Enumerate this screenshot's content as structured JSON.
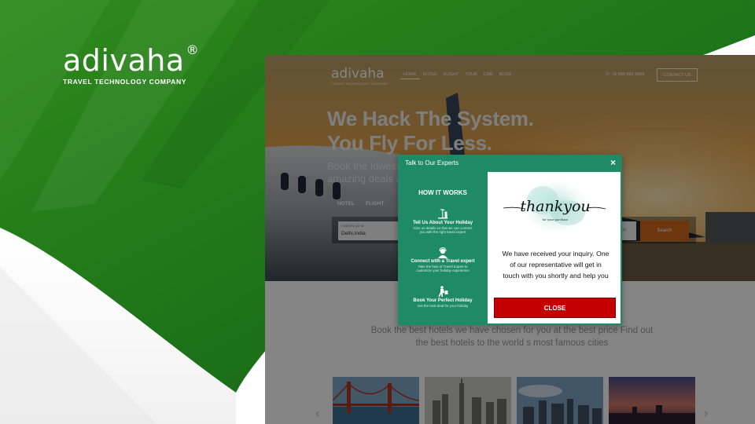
{
  "brand": {
    "name": "adivaha",
    "registered": "®",
    "tagline": "TRAVEL TECHNOLOGY COMPANY"
  },
  "site": {
    "logo_name": "adivaha",
    "logo_tagline": "TRAVEL TECHNOLOGY COMPANY",
    "nav": [
      "HOME",
      "HOTEL",
      "FLIGHT",
      "TOUR",
      "CAR",
      "BLOG"
    ],
    "phone": "P: +9 999 999 9999",
    "contact_label": "CONTACT US",
    "hero_line1": "We Hack The System.",
    "hero_line2": "You Fly For Less.",
    "hero_sub_line1": "Book the lowest a",
    "hero_sub_line2": "amazing deals and",
    "tabs": [
      "HOTEL",
      "FLIGHT"
    ],
    "search": {
      "label": "I want to go to",
      "value": "Delhi,India",
      "right_field": "(s)",
      "button": "Search"
    },
    "section_text_line1": "Book the best hotels we have chosen for you at the best price Find out",
    "section_text_line2": "the best hotels to the world s most famous cities",
    "arrows": {
      "prev": "‹",
      "next": "›"
    }
  },
  "modal": {
    "title": "Talk to Our Experts",
    "close_icon": "×",
    "how_title": "HOW IT WORKS",
    "steps": [
      {
        "icon": "holiday-icon",
        "title": "Tell Us About Your Holiday",
        "desc_line1": "Give us details so that we can connect",
        "desc_line2": "you with the right travel expert"
      },
      {
        "icon": "expert-icon",
        "title": "Connect with a Travel expert",
        "desc_line1": "Take the help of Travel Expert to",
        "desc_line2": "customize your holiday experience"
      },
      {
        "icon": "traveler-icon",
        "title": "Book Your Perfect Holiday",
        "desc_line1": "Get the best deal for your holiday",
        "desc_line2": ""
      }
    ],
    "thankyou_script": "thankyou",
    "thankyou_small": "for your purchase",
    "message_line1": "We have received your inquiry. One",
    "message_line2": "of our representative will get in",
    "message_line3": "touch with you shortly and help you",
    "close_label": "CLOSE"
  },
  "colors": {
    "brand_green": "#1f7a1f",
    "modal_green": "#1f8a66",
    "close_red": "#c40000",
    "search_orange": "#d2691e"
  }
}
